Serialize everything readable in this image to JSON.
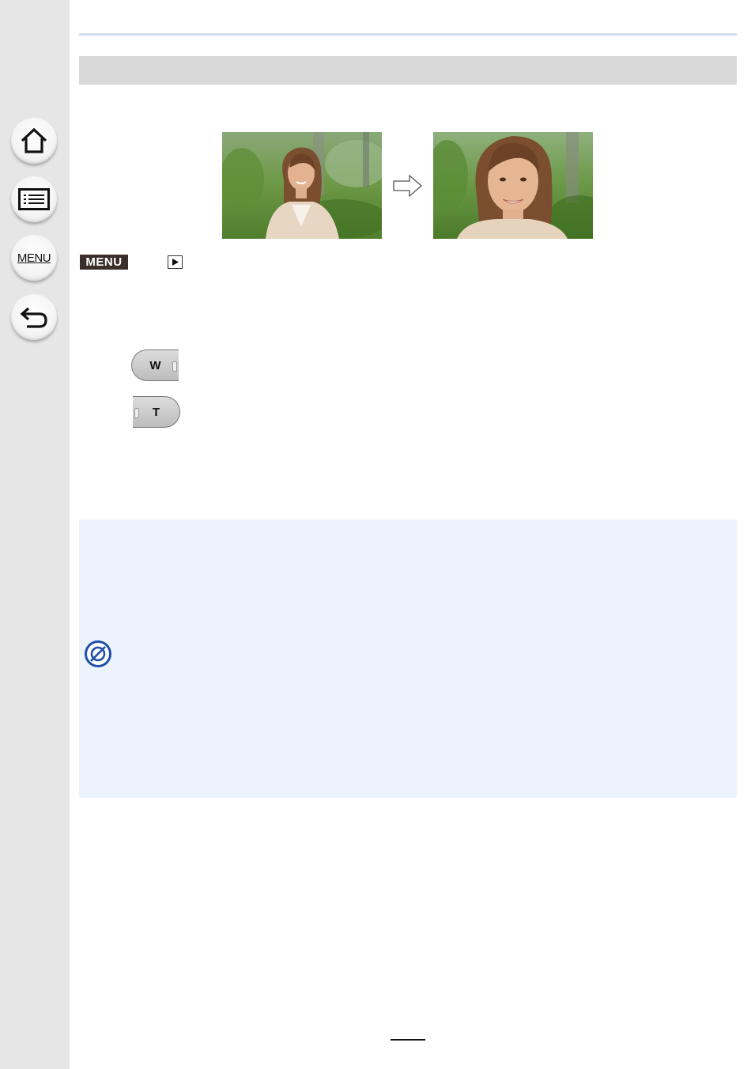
{
  "sidebar": {
    "home_icon": "home-icon",
    "contents_icon": "list-icon",
    "menu_label": "MENU",
    "back_icon": "return-icon"
  },
  "procedure": {
    "menu_badge_label": "MENU",
    "playback_icon": "playback-icon"
  },
  "zoom_lever": {
    "wide_label": "W",
    "tele_label": "T"
  },
  "notes": {
    "icon": "not-available-icon"
  },
  "colors": {
    "sidebar": "#e6e6e6",
    "title_bar": "#d9d9d9",
    "note_box": "#ecf3fd",
    "accent_blue": "#1f4fa8"
  }
}
